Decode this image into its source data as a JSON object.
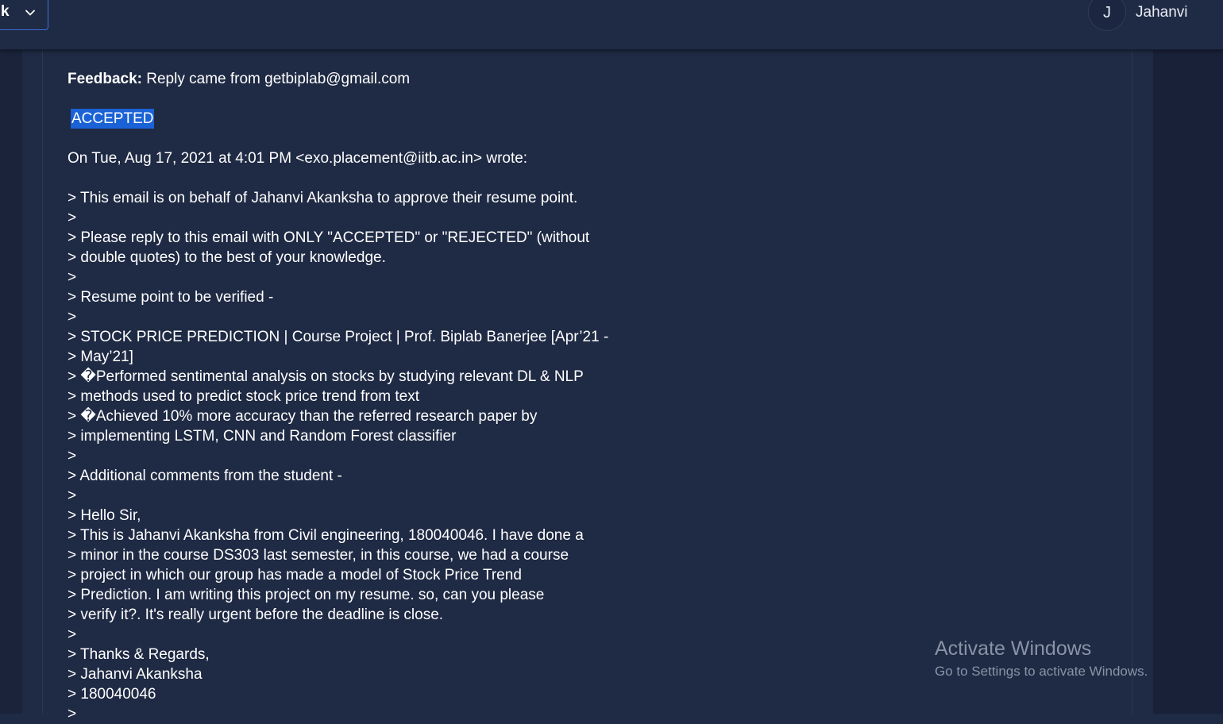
{
  "header": {
    "selector_text": "k",
    "selector_icon": "chevron-down-icon",
    "avatar_initial": "J",
    "user_name": "Jahanvi"
  },
  "email": {
    "feedback_label": "Feedback:",
    "feedback_text": "Reply came from getbiplab@gmail.com",
    "accepted_text": "ACCEPTED",
    "wrote_line": "On Tue, Aug 17, 2021 at 4:01 PM <exo.placement@iitb.ac.in> wrote:",
    "lines": [
      "> This email is on behalf of Jahanvi Akanksha to approve their resume point.",
      ">",
      "> Please reply to this email with ONLY \"ACCEPTED\" or \"REJECTED\" (without",
      "> double quotes) to the best of your knowledge.",
      ">",
      "> Resume point to be verified -",
      ">",
      "> STOCK PRICE PREDICTION | Course Project | Prof. Biplab Banerjee [Apr’21 -",
      "> May’21]",
      "> �Performed sentimental analysis on stocks by studying relevant DL & NLP",
      "> methods used to predict stock price trend from text",
      "> �Achieved 10% more accuracy than the referred research paper by",
      "> implementing LSTM, CNN and Random Forest classifier",
      ">",
      "> Additional comments from the student -",
      ">",
      "> Hello Sir,",
      "> This is Jahanvi Akanksha from Civil engineering, 180040046. I have done a",
      "> minor in the course DS303 last semester, in this course, we had a course",
      "> project in which our group has made a model of Stock Price Trend",
      "> Prediction. I am writing this project on my resume. so, can you please",
      "> verify it?. It's really urgent before the deadline is close.",
      ">",
      "> Thanks & Regards,",
      "> Jahanvi Akanksha",
      "> 180040046",
      ">"
    ]
  },
  "watermark": {
    "title": "Activate Windows",
    "subtitle": "Go to Settings to activate Windows."
  },
  "colors": {
    "background": "#1f2a44",
    "highlight": "#1a62d6",
    "selector_border": "#3b6fd8"
  }
}
